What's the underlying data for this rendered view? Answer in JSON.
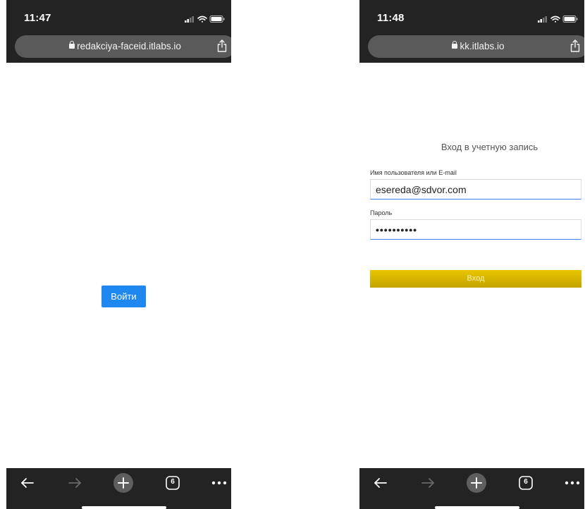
{
  "left_screen": {
    "status": {
      "time": "11:47"
    },
    "browser": {
      "url": "redakciya-faceid.itlabs.io"
    },
    "content": {
      "login_button": "Войти"
    },
    "toolbar": {
      "tab_count": "6"
    }
  },
  "right_screen": {
    "status": {
      "time": "11:48"
    },
    "browser": {
      "url": "kk.itlabs.io"
    },
    "form": {
      "title": "Вход в учетную запись",
      "username_label": "Имя пользователя или E-mail",
      "username_value": "esereda@sdvor.com",
      "password_label": "Пароль",
      "password_value": "••••••••••",
      "submit_label": "Вход"
    },
    "toolbar": {
      "tab_count": "6"
    }
  },
  "colors": {
    "browser_chrome": "#232323",
    "url_bar": "#5a5a5a",
    "primary_button": "#1e88f0",
    "submit_button": "#d6b500",
    "input_focus_line": "#3d7ff0"
  },
  "icons": [
    "lock-icon",
    "share-icon",
    "signal-icon",
    "wifi-icon",
    "battery-icon",
    "back-arrow-icon",
    "forward-arrow-icon",
    "new-tab-plus-icon",
    "tabs-count-icon",
    "more-dots-icon"
  ]
}
